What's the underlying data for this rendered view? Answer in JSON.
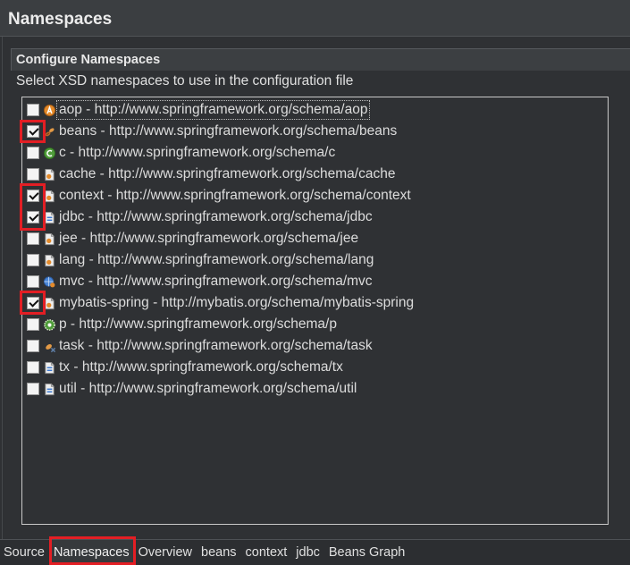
{
  "editor": {
    "title": "Namespaces",
    "section": {
      "title": "Configure Namespaces",
      "description": "Select XSD namespaces to use in the configuration file"
    },
    "namespaces": [
      {
        "label": "aop - http://www.springframework.org/schema/aop",
        "checked": false,
        "focused": true,
        "highlighted": false,
        "icon": "aop-namespace-icon"
      },
      {
        "label": "beans - http://www.springframework.org/schema/beans",
        "checked": true,
        "focused": false,
        "highlighted": true,
        "icon": "beans-namespace-icon"
      },
      {
        "label": "c - http://www.springframework.org/schema/c",
        "checked": false,
        "focused": false,
        "highlighted": false,
        "icon": "c-namespace-icon"
      },
      {
        "label": "cache - http://www.springframework.org/schema/cache",
        "checked": false,
        "focused": false,
        "highlighted": false,
        "icon": "cache-namespace-icon"
      },
      {
        "label": "context - http://www.springframework.org/schema/context",
        "checked": true,
        "focused": false,
        "highlighted": true,
        "icon": "context-namespace-icon"
      },
      {
        "label": "jdbc - http://www.springframework.org/schema/jdbc",
        "checked": true,
        "focused": false,
        "highlighted": true,
        "icon": "jdbc-namespace-icon"
      },
      {
        "label": "jee - http://www.springframework.org/schema/jee",
        "checked": false,
        "focused": false,
        "highlighted": false,
        "icon": "jee-namespace-icon"
      },
      {
        "label": "lang - http://www.springframework.org/schema/lang",
        "checked": false,
        "focused": false,
        "highlighted": false,
        "icon": "lang-namespace-icon"
      },
      {
        "label": "mvc - http://www.springframework.org/schema/mvc",
        "checked": false,
        "focused": false,
        "highlighted": false,
        "icon": "mvc-namespace-icon"
      },
      {
        "label": "mybatis-spring - http://mybatis.org/schema/mybatis-spring",
        "checked": true,
        "focused": false,
        "highlighted": true,
        "icon": "mybatis-spring-namespace-icon"
      },
      {
        "label": "p - http://www.springframework.org/schema/p",
        "checked": false,
        "focused": false,
        "highlighted": false,
        "icon": "p-namespace-icon"
      },
      {
        "label": "task - http://www.springframework.org/schema/task",
        "checked": false,
        "focused": false,
        "highlighted": false,
        "icon": "task-namespace-icon"
      },
      {
        "label": "tx - http://www.springframework.org/schema/tx",
        "checked": false,
        "focused": false,
        "highlighted": false,
        "icon": "tx-namespace-icon"
      },
      {
        "label": "util - http://www.springframework.org/schema/util",
        "checked": false,
        "focused": false,
        "highlighted": false,
        "icon": "util-namespace-icon"
      }
    ]
  },
  "tabs": [
    {
      "label": "Source",
      "active": false
    },
    {
      "label": "Namespaces",
      "active": true,
      "highlighted": true
    },
    {
      "label": "Overview",
      "active": false
    },
    {
      "label": "beans",
      "active": false
    },
    {
      "label": "context",
      "active": false
    },
    {
      "label": "jdbc",
      "active": false
    },
    {
      "label": "Beans Graph",
      "active": false
    }
  ],
  "colors": {
    "highlight": "#e31e24",
    "background": "#2f3134",
    "header_background": "#3b3e41"
  }
}
